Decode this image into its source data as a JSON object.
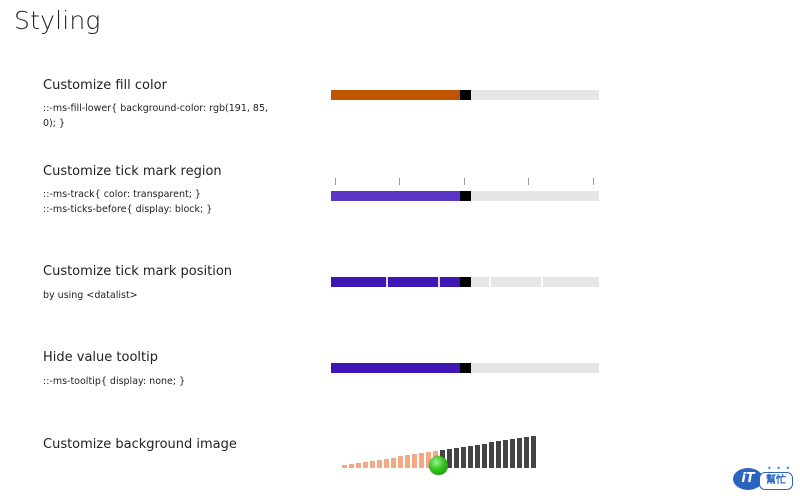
{
  "page": {
    "title": "Styling"
  },
  "sections": [
    {
      "label": "Customize fill color",
      "desc_lines": [
        "::-ms-fill-lower{ background-color: rgb(191, 85,",
        "0); }"
      ],
      "fill_color": "#bf5500",
      "value_fraction": 0.5
    },
    {
      "label": "Customize tick mark region",
      "desc_lines": [
        "::-ms-track{ color: transparent; }",
        "::-ms-ticks-before{ display: block; }"
      ],
      "fill_color": "#5a35c8",
      "value_fraction": 0.5
    },
    {
      "label": "Customize tick mark position",
      "desc_lines": [
        "by using <datalist>"
      ],
      "fill_color": "#3f17b4",
      "value_fraction": 0.5
    },
    {
      "label": "Hide value tooltip",
      "desc_lines": [
        "::-ms-tooltip{ display: none; }"
      ],
      "fill_color": "#3f17b4",
      "value_fraction": 0.5
    },
    {
      "label": "Customize background image",
      "desc_lines": [],
      "value_fraction": 0.5
    }
  ],
  "colors": {
    "track": "#e6e6e6",
    "thumb": "#000000",
    "bar_filled": "#f4a884",
    "bar_unfilled": "#444444",
    "thumb_ball": "#32c21c"
  },
  "logo": {
    "text_it": "iT",
    "text_bang": "幫忙"
  }
}
